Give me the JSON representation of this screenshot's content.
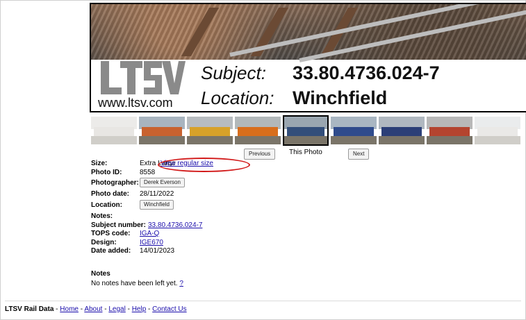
{
  "header": {
    "logo_text": "LTSV",
    "url": "www.ltsv.com",
    "subject_label": "Subject:",
    "subject_value": "33.80.4736.024-7",
    "location_label": "Location:",
    "location_value": "Winchfield"
  },
  "thumbnails": [
    {
      "color": "#c9c7c2",
      "wagon": "#bfb9b0",
      "faded": true
    },
    {
      "color": "#a8b4bf",
      "wagon": "#c8622f",
      "faded": false
    },
    {
      "color": "#b7bcc0",
      "wagon": "#d7a129",
      "faded": false
    },
    {
      "color": "#b2b8ba",
      "wagon": "#d86e1c",
      "faded": false
    },
    {
      "color": "#9aa6b0",
      "wagon": "#334e7a",
      "faded": false,
      "current": true
    },
    {
      "color": "#a9b6c2",
      "wagon": "#2f4b8c",
      "faded": false
    },
    {
      "color": "#b0b8c0",
      "wagon": "#2c3f77",
      "faded": false
    },
    {
      "color": "#b8b8b8",
      "wagon": "#b4442f",
      "faded": false
    },
    {
      "color": "#c6c9cc",
      "wagon": "#c4c1bb",
      "faded": true
    }
  ],
  "nav": {
    "previous_label": "Previous",
    "this_photo_label": "This Photo",
    "next_label": "Next"
  },
  "details": {
    "size_label": "Size:",
    "size_value": "Extra Large",
    "view_regular_label": "View regular size",
    "photo_id_label": "Photo ID:",
    "photo_id_value": "8558",
    "photographer_label": "Photographer:",
    "photographer_value": "Derek Everson",
    "photo_date_label": "Photo date:",
    "photo_date_value": "28/11/2022",
    "location_label": "Location:",
    "location_value": "Winchfield",
    "notes_label": "Notes:",
    "subject_number_label": "Subject number:",
    "subject_number_value": "33.80.4736.024-7",
    "tops_code_label": "TOPS code:",
    "tops_code_value": "IGA-Q",
    "design_label": "Design:",
    "design_value": "IGE670",
    "date_added_label": "Date added:",
    "date_added_value": "14/01/2023"
  },
  "notes": {
    "title": "Notes",
    "text": "No notes have been left yet.",
    "help_link": "?"
  },
  "footer": {
    "brand": "LTSV Rail Data",
    "sep": " - ",
    "links": [
      "Home",
      "About",
      "Legal",
      "Help",
      "Contact Us"
    ]
  },
  "colors": {
    "link": "#1a0dab",
    "highlight": "#d21a1a"
  }
}
